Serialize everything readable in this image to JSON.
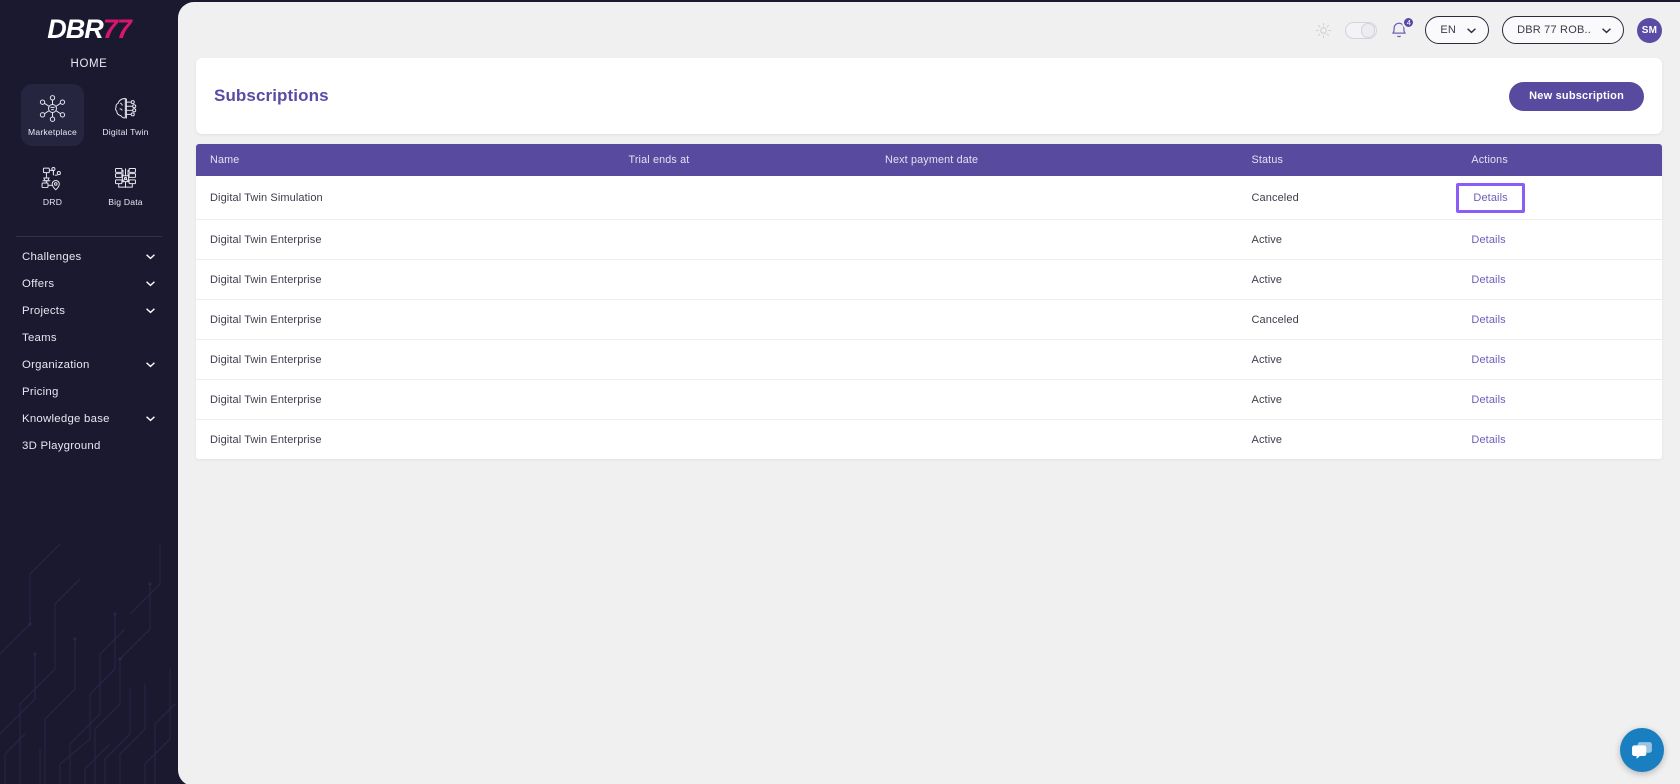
{
  "brand": {
    "logo_white": "DBR",
    "logo_pink": "77",
    "home_label": "HOME",
    "accent_purple": "#584a9e",
    "accent_pink": "#d6176b",
    "focus_outline": "#8b5cf6"
  },
  "sidebar": {
    "tiles": [
      {
        "label": "Marketplace",
        "icon": "network-nodes-icon",
        "active": true
      },
      {
        "label": "Digital Twin",
        "icon": "brain-circuit-icon",
        "active": false
      },
      {
        "label": "DRD",
        "icon": "flow-pin-icon",
        "active": false
      },
      {
        "label": "Big Data",
        "icon": "server-stack-icon",
        "active": false
      }
    ],
    "nav": [
      {
        "label": "Challenges",
        "expandable": true
      },
      {
        "label": "Offers",
        "expandable": true
      },
      {
        "label": "Projects",
        "expandable": true
      },
      {
        "label": "Teams",
        "expandable": false
      },
      {
        "label": "Organization",
        "expandable": true
      },
      {
        "label": "Pricing",
        "expandable": false
      },
      {
        "label": "Knowledge base",
        "expandable": true
      },
      {
        "label": "3D Playground",
        "expandable": false
      }
    ]
  },
  "topbar": {
    "theme_icon": "sun-icon",
    "theme_toggle_state": "off",
    "notifications_icon": "bell-icon",
    "notifications_count": "4",
    "language": "EN",
    "organization": "DBR 77 ROB..",
    "avatar_initials": "SM"
  },
  "page": {
    "title": "Subscriptions",
    "new_button": "New subscription"
  },
  "table": {
    "columns": [
      "Name",
      "Trial ends at",
      "Next payment date",
      "Status",
      "Actions"
    ],
    "action_label": "Details",
    "focused_row_index": 0,
    "rows": [
      {
        "name": "Digital Twin Simulation",
        "trial_ends_at": "",
        "next_payment_date": "",
        "status": "Canceled",
        "action": "Details"
      },
      {
        "name": "Digital Twin Enterprise",
        "trial_ends_at": "",
        "next_payment_date": "",
        "status": "Active",
        "action": "Details"
      },
      {
        "name": "Digital Twin Enterprise",
        "trial_ends_at": "",
        "next_payment_date": "",
        "status": "Active",
        "action": "Details"
      },
      {
        "name": "Digital Twin Enterprise",
        "trial_ends_at": "",
        "next_payment_date": "",
        "status": "Canceled",
        "action": "Details"
      },
      {
        "name": "Digital Twin Enterprise",
        "trial_ends_at": "",
        "next_payment_date": "",
        "status": "Active",
        "action": "Details"
      },
      {
        "name": "Digital Twin Enterprise",
        "trial_ends_at": "",
        "next_payment_date": "",
        "status": "Active",
        "action": "Details"
      },
      {
        "name": "Digital Twin Enterprise",
        "trial_ends_at": "",
        "next_payment_date": "",
        "status": "Active",
        "action": "Details"
      }
    ]
  },
  "chat": {
    "icon": "chat-bubble-icon"
  }
}
